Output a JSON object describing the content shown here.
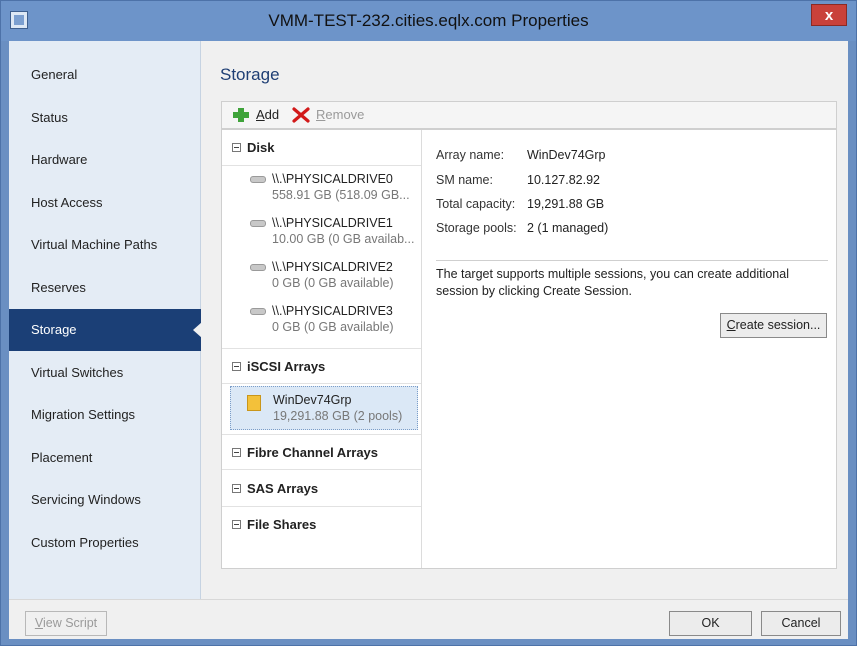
{
  "window": {
    "title": "VMM-TEST-232.cities.eqlx.com Properties",
    "close_glyph": "x"
  },
  "nav": {
    "items": [
      {
        "label": "General"
      },
      {
        "label": "Status"
      },
      {
        "label": "Hardware"
      },
      {
        "label": "Host Access"
      },
      {
        "label": "Virtual Machine Paths"
      },
      {
        "label": "Reserves"
      },
      {
        "label": "Storage"
      },
      {
        "label": "Virtual Switches"
      },
      {
        "label": "Migration Settings"
      },
      {
        "label": "Placement"
      },
      {
        "label": "Servicing Windows"
      },
      {
        "label": "Custom Properties"
      }
    ],
    "active": "Storage"
  },
  "main": {
    "title": "Storage",
    "toolbar": {
      "add": {
        "prefix": "",
        "accel": "A",
        "rest": "dd"
      },
      "remove": {
        "prefix": "",
        "accel": "R",
        "rest": "emove"
      }
    },
    "tree": {
      "disk": {
        "label": "Disk",
        "items": [
          {
            "name": "\\\\.\\PHYSICALDRIVE0",
            "sub": "558.91 GB (518.09 GB..."
          },
          {
            "name": "\\\\.\\PHYSICALDRIVE1",
            "sub": "10.00 GB (0 GB availab..."
          },
          {
            "name": "\\\\.\\PHYSICALDRIVE2",
            "sub": "0 GB (0 GB available)"
          },
          {
            "name": "\\\\.\\PHYSICALDRIVE3",
            "sub": "0 GB (0 GB available)"
          }
        ]
      },
      "iscsi": {
        "label": "iSCSI Arrays",
        "items": [
          {
            "name": "WinDev74Grp",
            "sub": "19,291.88 GB (2 pools)"
          }
        ]
      },
      "fibre": {
        "label": "Fibre Channel Arrays"
      },
      "sas": {
        "label": "SAS Arrays"
      },
      "file_shares": {
        "label": "File Shares"
      }
    },
    "details": {
      "array_name": {
        "label": "Array name:",
        "value": "WinDev74Grp"
      },
      "sm_name": {
        "label": "SM name:",
        "value": "10.127.82.92"
      },
      "total_capacity": {
        "label": "Total capacity:",
        "value": "19,291.88 GB"
      },
      "storage_pools": {
        "label": "Storage pools:",
        "value": "2 (1 managed)"
      },
      "info": "The target supports multiple sessions, you can create additional session by clicking Create Session.",
      "create_session": {
        "accel": "C",
        "rest": "reate session..."
      }
    }
  },
  "footer": {
    "view_script": {
      "accel": "V",
      "rest": "iew Script"
    },
    "ok": "OK",
    "cancel": "Cancel"
  },
  "colors": {
    "nav_active": "#1b3f76",
    "title_text": "#1e3e74",
    "titlebar": "#6d94c9"
  }
}
